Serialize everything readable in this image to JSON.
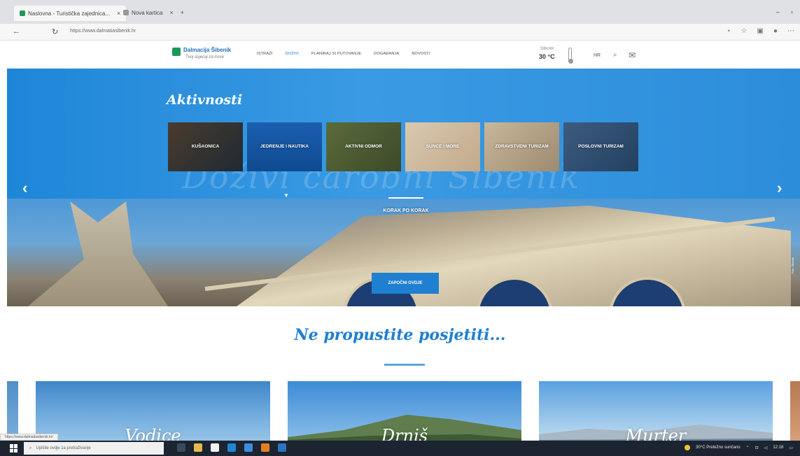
{
  "browser": {
    "tabs": [
      {
        "label": "Naslovna - Turistička zajednica..."
      },
      {
        "label": "Nova kartica"
      }
    ],
    "tab_close_glyph": "×",
    "new_tab_glyph": "+",
    "url": "https://www.dalmatiasibenik.hr",
    "window_controls": {
      "minimize": "–",
      "maximize": "▫"
    }
  },
  "site": {
    "logo_title": "Dalmacija Šibenik",
    "logo_tagline": "Tvoj osjećaj za more",
    "nav": [
      {
        "label": "ISTRAŽI"
      },
      {
        "label": "DOŽIVI"
      },
      {
        "label": "PLANIRAJ SI PUTOVANJE"
      },
      {
        "label": "DOGAĐANJA"
      },
      {
        "label": "NOVOSTI"
      }
    ],
    "weather_label": "ŠIBENIK",
    "weather_temp": "30 °C",
    "language": "HR"
  },
  "hero": {
    "section_title": "Aktivnosti",
    "background_script": "Doživi čarobni Šibenik",
    "tiles": [
      {
        "label": "Kušaonica"
      },
      {
        "label": "Jedrenje i nautika"
      },
      {
        "label": "Aktivni odmor"
      },
      {
        "label": "Sunce i more"
      },
      {
        "label": "Zdravstveni turizam"
      },
      {
        "label": "Poslovni turizam"
      }
    ],
    "caption": "KORAK PO KORAK",
    "cta_label": "ZAPOČNI OVDJE",
    "photo_credit": "Foto: Šibenik"
  },
  "dont_miss": {
    "title": "Ne propustite posjetiti...",
    "destinations": [
      {
        "name": "Vodice"
      },
      {
        "name": "Drniš"
      },
      {
        "name": "Murter"
      }
    ]
  },
  "status_bar_url": "https://www.dalmatiasibenik.hr/",
  "taskbar": {
    "search_placeholder": "Upišite ovdje za pretraživanje",
    "weather": "30°C Pretežno sunčano",
    "time": "12:18"
  },
  "colors": {
    "accent_blue": "#1f7fd0",
    "hero_blue": "#2b8ad6",
    "logo_green": "#1a9a5a",
    "taskbar": "#1b2430"
  }
}
